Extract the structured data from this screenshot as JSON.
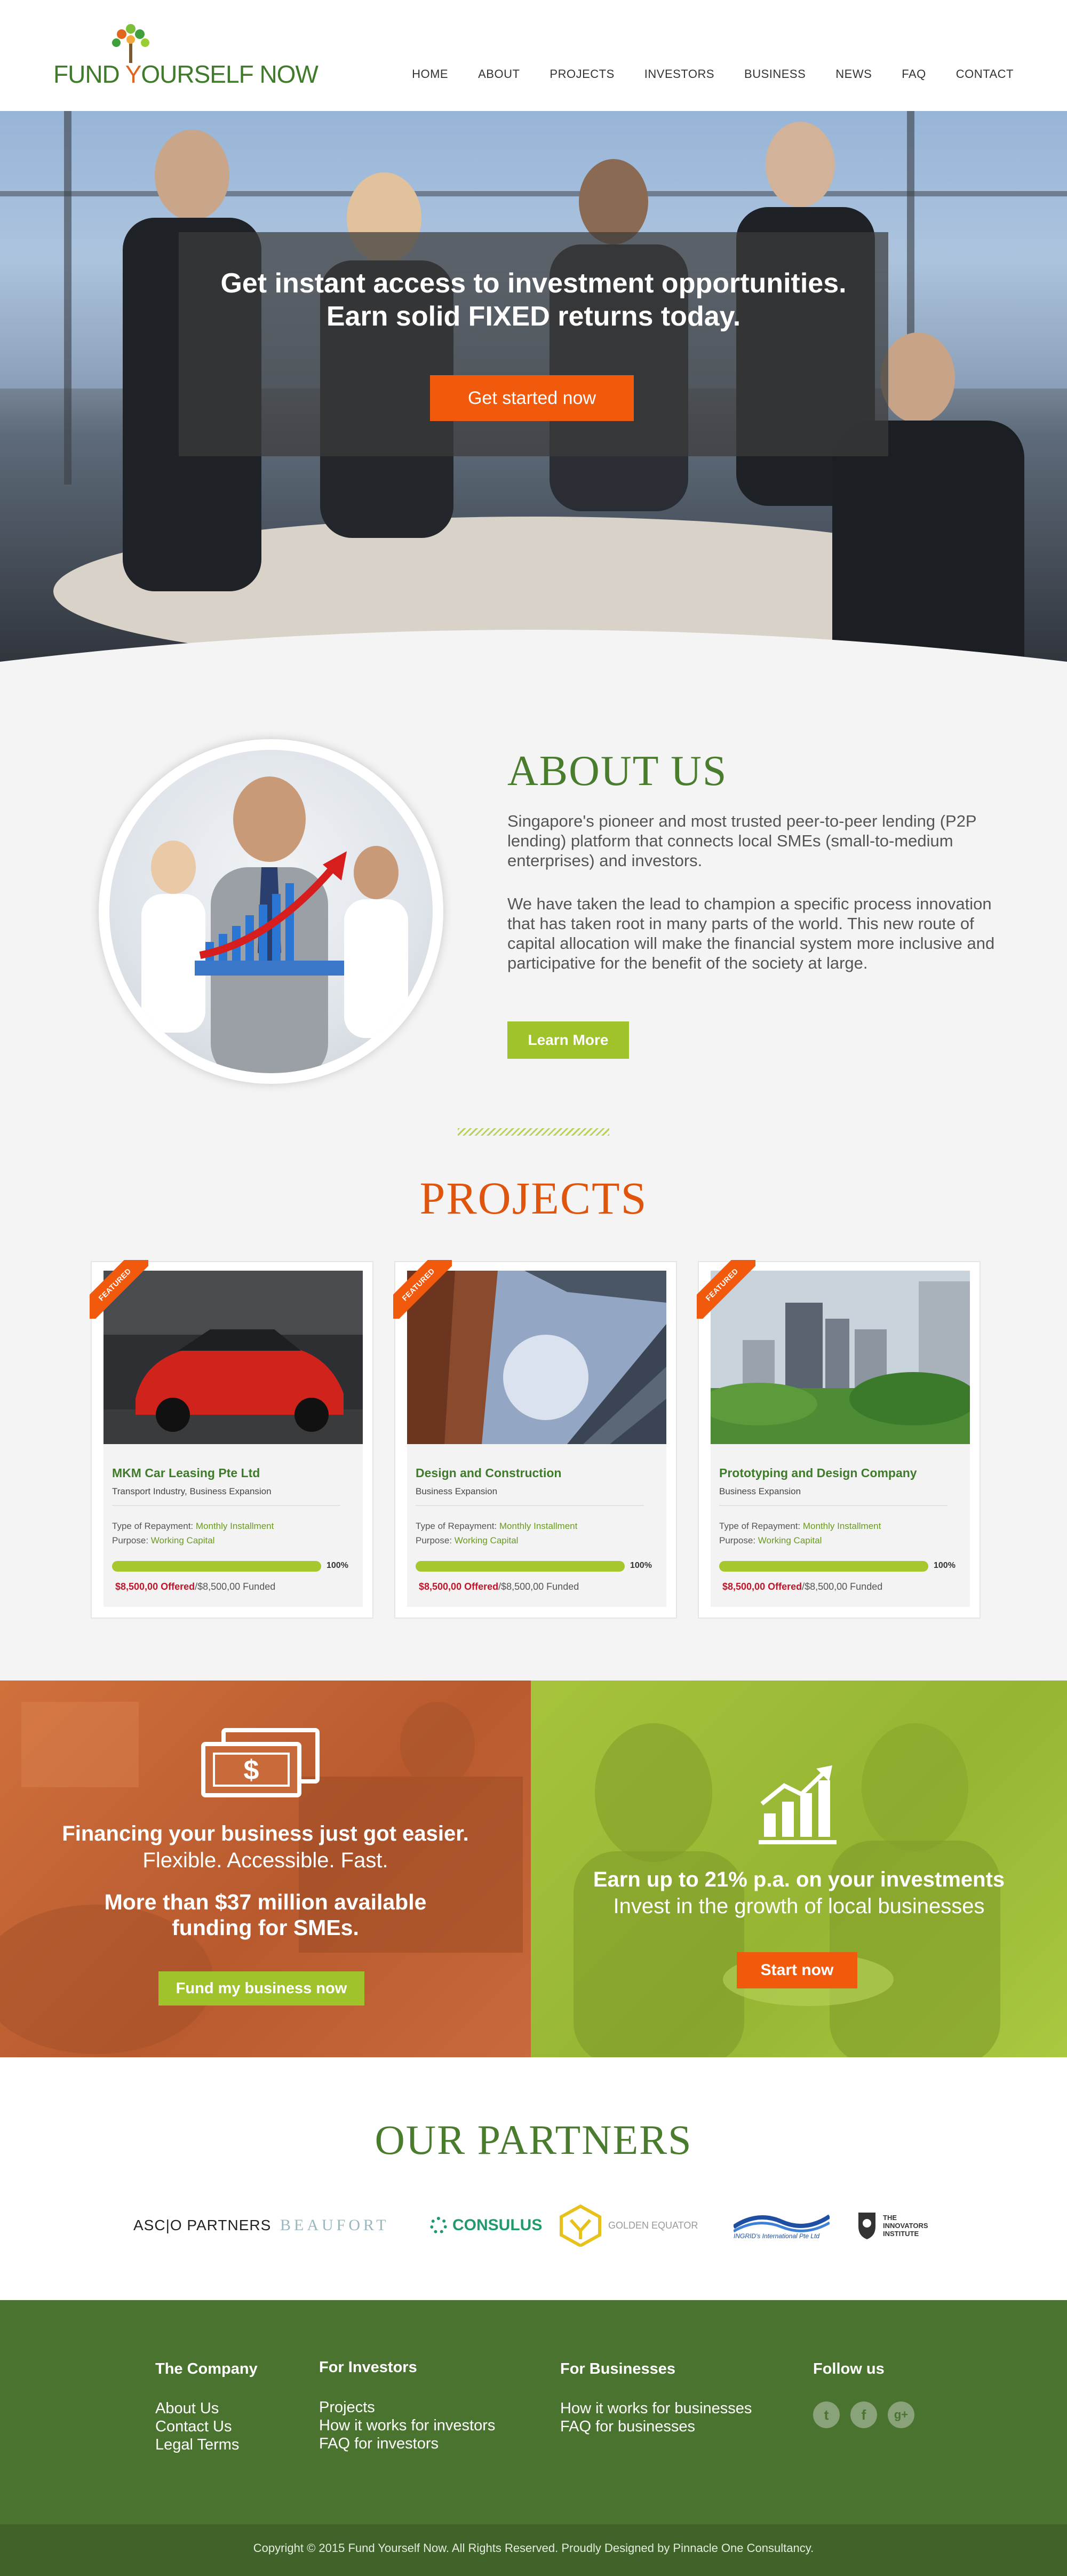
{
  "header": {
    "logo_text_1": "FUND ",
    "logo_text_o": "Y",
    "logo_text_2": "OURSELF NOW",
    "nav": [
      "HOME",
      "ABOUT",
      "PROJECTS",
      "INVESTORS",
      "BUSINESS",
      "NEWS",
      "FAQ",
      "CONTACT"
    ]
  },
  "hero": {
    "title_line1": "Get instant access to investment opportunities.",
    "title_line2": "Earn solid FIXED returns today.",
    "cta": "Get started now"
  },
  "about": {
    "title": "ABOUT US",
    "p1": "Singapore's pioneer and most trusted peer-to-peer lending (P2P lending) platform that connects local SMEs (small-to-medium enterprises) and investors.",
    "p2": "We have taken the lead to champion a specific process innovation that has taken root in many parts of the world. This new route of capital allocation will make the financial system more inclusive and participative for the benefit of the society at large.",
    "button": "Learn More"
  },
  "projects": {
    "title": "PROJECTS",
    "ribbon": "FEATURED",
    "repayment_label": "Type of Repayment:",
    "purpose_label": "Purpose:",
    "items": [
      {
        "name": "MKM Car Leasing Pte Ltd",
        "sub": "Transport Industry, Business Expansion",
        "repayment": "Monthly Installment",
        "purpose": "Working Capital",
        "percent": "100%",
        "progress": 1.0,
        "offered": "$8,500,00 Offered",
        "funded": "/$8,500,00 Funded"
      },
      {
        "name": "Design and Construction",
        "sub": "Business Expansion",
        "repayment": "Monthly Installment",
        "purpose": "Working Capital",
        "percent": "100%",
        "progress": 1.0,
        "offered": "$8,500,00 Offered",
        "funded": "/$8,500,00 Funded"
      },
      {
        "name": "Prototyping and Design Company",
        "sub": "Business Expansion",
        "repayment": "Monthly Installment",
        "purpose": "Working Capital",
        "percent": "100%",
        "progress": 1.0,
        "offered": "$8,500,00 Offered",
        "funded": "/$8,500,00 Funded"
      }
    ]
  },
  "promo_business": {
    "line1": "Financing your business just got easier.",
    "line2": "Flexible. Accessible. Fast.",
    "line3a": "More than $37 million available",
    "line3b": "funding for SMEs.",
    "button": "Fund my business now",
    "icon_symbol": "$"
  },
  "promo_investor": {
    "line1": "Earn up to 21% p.a. on your investments",
    "line2": "Invest in the growth of local businesses",
    "button": "Start now"
  },
  "partners": {
    "title": "OUR PARTNERS",
    "logos": [
      "ASC|O PARTNERS",
      "BEAUFORT",
      "CONSULUS",
      "GOLDEN EQUATOR",
      "INGRID's International Pte Ltd",
      "THE INNOVATORS INSTITUTE"
    ]
  },
  "footer": {
    "company_head": "The Company",
    "company_links": [
      "About Us",
      "Contact Us",
      "Legal Terms"
    ],
    "investors_head": "For Investors",
    "investors_links": [
      "Projects",
      "How it works for investors",
      "FAQ for investors"
    ],
    "business_head": "For Businesses",
    "business_links": [
      "How it works for businesses",
      "FAQ for businesses"
    ],
    "follow_head": "Follow us",
    "social": [
      "twitter-icon",
      "facebook-icon",
      "google-plus-icon"
    ],
    "copyright": "Copyright © 2015 Fund Yourself Now. All Rights Reserved.  Proudly Designed by Pinnacle One Consultancy."
  },
  "colors": {
    "green": "#4a7c2e",
    "orange": "#f15a0c",
    "lime": "#a0c32b",
    "footer": "#4a7330"
  }
}
